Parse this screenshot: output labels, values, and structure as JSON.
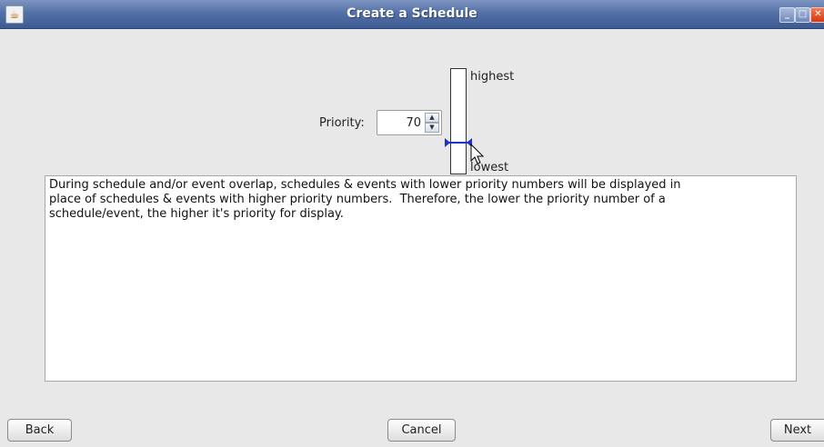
{
  "window": {
    "title": "Create a Schedule",
    "controls": {
      "minimize": "_",
      "maximize": "□",
      "close": "✕"
    }
  },
  "priority": {
    "label": "Priority:",
    "value": "70",
    "slider_high_label": "highest",
    "slider_low_label": "lowest",
    "slider_level_from_top_fraction": 0.7
  },
  "description": "During schedule and/or event overlap, schedules & events with lower priority numbers will be displayed in\nplace of schedules & events with higher priority numbers.  Therefore, the lower the priority number of a\nschedule/event, the higher it's priority for display.",
  "buttons": {
    "back": "Back",
    "cancel": "Cancel",
    "next": "Next"
  },
  "colors": {
    "titlebar": "#5471a6",
    "slider_thumb": "#1a33cc"
  }
}
